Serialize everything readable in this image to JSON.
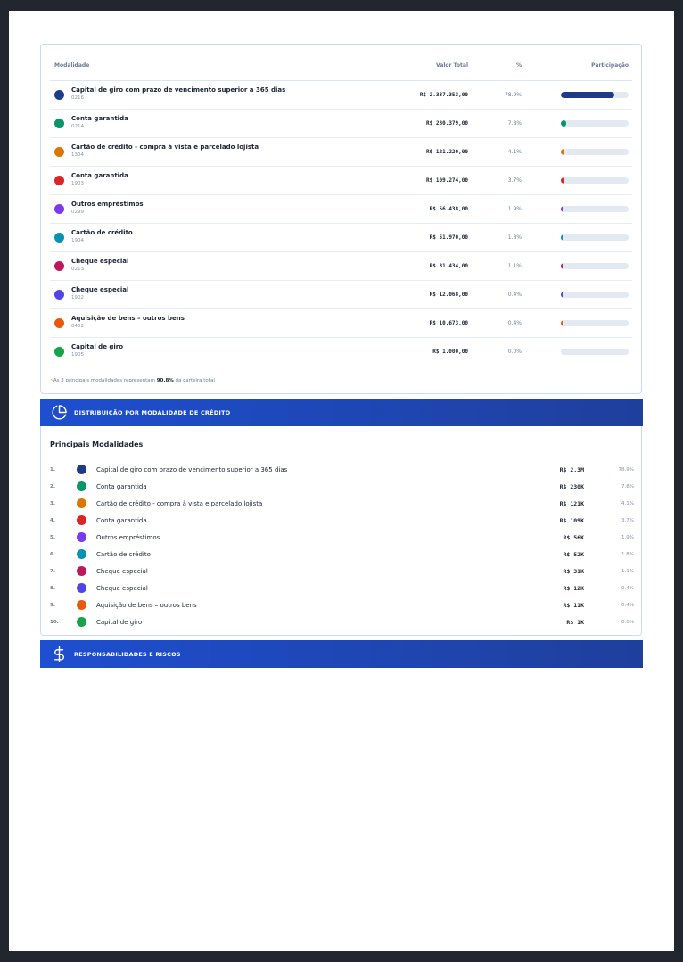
{
  "table": {
    "headers": {
      "modalidade": "Modalidade",
      "valor": "Valor Total",
      "pct": "%",
      "participacao": "Participação"
    },
    "rows": [
      {
        "name": "Capital de giro com prazo de vencimento superior a 365 dias",
        "code": "0216",
        "value": "R$ 2.337.353,00",
        "pct": "78.9%",
        "share": 0.789,
        "color": "#1e3a8a"
      },
      {
        "name": "Conta garantida",
        "code": "0214",
        "value": "R$ 230.379,00",
        "pct": "7.8%",
        "share": 0.078,
        "color": "#059669"
      },
      {
        "name": "Cartão de crédito - compra à vista e parcelado lojista",
        "code": "1304",
        "value": "R$ 121.220,00",
        "pct": "4.1%",
        "share": 0.041,
        "color": "#d97706"
      },
      {
        "name": "Conta garantida",
        "code": "1903",
        "value": "R$ 109.274,00",
        "pct": "3.7%",
        "share": 0.037,
        "color": "#dc2626"
      },
      {
        "name": "Outros empréstimos",
        "code": "0299",
        "value": "R$ 56.438,00",
        "pct": "1.9%",
        "share": 0.019,
        "color": "#7c3aed"
      },
      {
        "name": "Cartão de crédito",
        "code": "1904",
        "value": "R$ 51.970,00",
        "pct": "1.8%",
        "share": 0.018,
        "color": "#0891b2"
      },
      {
        "name": "Cheque especial",
        "code": "0213",
        "value": "R$ 31.434,00",
        "pct": "1.1%",
        "share": 0.011,
        "color": "#be185d"
      },
      {
        "name": "Cheque especial",
        "code": "1902",
        "value": "R$ 12.068,00",
        "pct": "0.4%",
        "share": 0.004,
        "color": "#4f46e5"
      },
      {
        "name": "Aquisição de bens – outros bens",
        "code": "0402",
        "value": "R$ 10.673,00",
        "pct": "0.4%",
        "share": 0.004,
        "color": "#ea580c"
      },
      {
        "name": "Capital de giro",
        "code": "1905",
        "value": "R$ 1.000,00",
        "pct": "0.0%",
        "share": 0.0,
        "color": "#16a34a"
      }
    ],
    "footer": {
      "prefix": "As 3 principais modalidades representam ",
      "highlight": "90.8%",
      "suffix": " da carteira total"
    }
  },
  "banner1": {
    "title": "DISTRIBUIÇÃO POR MODALIDADE DE CRÉDITO",
    "icon": "pie-chart-icon"
  },
  "list": {
    "title": "Principais Modalidades",
    "items": [
      {
        "num": "1.",
        "name": "Capital de giro com prazo de vencimento superior a 365 dias",
        "value": "R$ 2.3M",
        "pct": "78.9%",
        "color": "#1e3a8a"
      },
      {
        "num": "2.",
        "name": "Conta garantida",
        "value": "R$ 230K",
        "pct": "7.8%",
        "color": "#059669"
      },
      {
        "num": "3.",
        "name": "Cartão de crédito - compra à vista e parcelado lojista",
        "value": "R$ 121K",
        "pct": "4.1%",
        "color": "#d97706"
      },
      {
        "num": "4.",
        "name": "Conta garantida",
        "value": "R$ 109K",
        "pct": "3.7%",
        "color": "#dc2626"
      },
      {
        "num": "5.",
        "name": "Outros empréstimos",
        "value": "R$ 56K",
        "pct": "1.9%",
        "color": "#7c3aed"
      },
      {
        "num": "6.",
        "name": "Cartão de crédito",
        "value": "R$ 52K",
        "pct": "1.8%",
        "color": "#0891b2"
      },
      {
        "num": "7.",
        "name": "Cheque especial",
        "value": "R$ 31K",
        "pct": "1.1%",
        "color": "#be185d"
      },
      {
        "num": "8.",
        "name": "Cheque especial",
        "value": "R$ 12K",
        "pct": "0.4%",
        "color": "#4f46e5"
      },
      {
        "num": "9.",
        "name": "Aquisição de bens – outros bens",
        "value": "R$ 11K",
        "pct": "0.4%",
        "color": "#ea580c"
      },
      {
        "num": "10.",
        "name": "Capital de giro",
        "value": "R$ 1K",
        "pct": "0.0%",
        "color": "#16a34a"
      }
    ]
  },
  "banner2": {
    "title": "RESPONSABILIDADES E RISCOS",
    "icon": "dollar-icon"
  }
}
